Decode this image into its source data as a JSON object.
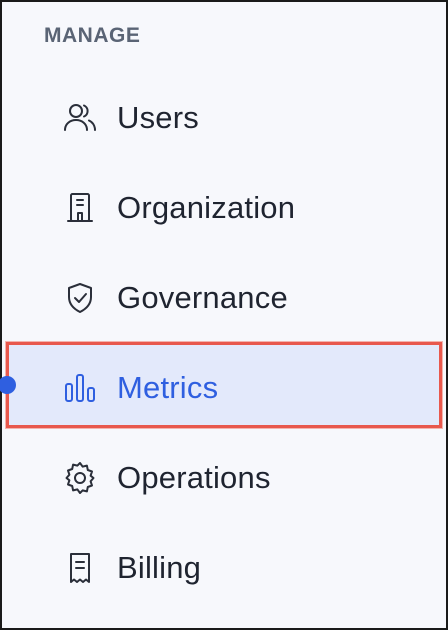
{
  "sidebar": {
    "section_title": "MANAGE",
    "items": [
      {
        "label": "Users",
        "icon": "users-icon"
      },
      {
        "label": "Organization",
        "icon": "building-icon"
      },
      {
        "label": "Governance",
        "icon": "shield-check-icon"
      },
      {
        "label": "Metrics",
        "icon": "bar-chart-icon",
        "active": true
      },
      {
        "label": "Operations",
        "icon": "gear-icon"
      },
      {
        "label": "Billing",
        "icon": "receipt-icon"
      }
    ],
    "accent_color": "#2f5fe0",
    "highlight_border_color": "#e8584d"
  }
}
